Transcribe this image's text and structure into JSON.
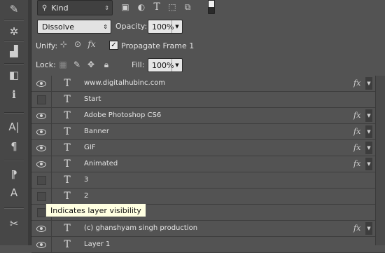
{
  "toolbar": {
    "tools": [
      {
        "icon": "brush-settings-icon",
        "glyph": "✎"
      },
      {
        "icon": "asterisk-icon",
        "glyph": "✲"
      },
      {
        "icon": "histogram-icon",
        "glyph": "▟"
      },
      {
        "icon": "adjustments-icon",
        "glyph": "◧"
      },
      {
        "icon": "info-icon",
        "glyph": "ℹ"
      },
      {
        "icon": "character-icon",
        "glyph": "A|"
      },
      {
        "icon": "paragraph-icon",
        "glyph": "¶"
      },
      {
        "icon": "paragraph-styles-icon",
        "glyph": "⁋"
      },
      {
        "icon": "character-styles-icon",
        "glyph": "A"
      },
      {
        "icon": "tools-icon",
        "glyph": "✂"
      }
    ]
  },
  "filter": {
    "kind_label": "Kind",
    "icons": [
      "image-filter-icon",
      "adjustment-filter-icon",
      "type-filter-icon",
      "shape-filter-icon",
      "smart-object-filter-icon"
    ]
  },
  "blend": {
    "mode": "Dissolve",
    "opacity_label": "Opacity:",
    "opacity_value": "100%"
  },
  "unify": {
    "label": "Unify:",
    "propagate_label": "Propagate Frame 1",
    "propagate_checked": true
  },
  "lock": {
    "label": "Lock:",
    "fill_label": "Fill:",
    "fill_value": "100%"
  },
  "layers": [
    {
      "name": "www.digitalhubinc.com",
      "visible": true,
      "fx": true
    },
    {
      "name": "Start",
      "visible": false,
      "fx": false
    },
    {
      "name": "Adobe Photoshop CS6",
      "visible": true,
      "fx": true
    },
    {
      "name": "Banner",
      "visible": true,
      "fx": true
    },
    {
      "name": "GIF",
      "visible": true,
      "fx": true
    },
    {
      "name": "Animated",
      "visible": true,
      "fx": true
    },
    {
      "name": "3",
      "visible": false,
      "fx": false
    },
    {
      "name": "2",
      "visible": false,
      "fx": false
    },
    {
      "name": "",
      "visible": false,
      "fx": false
    },
    {
      "name": "(c) ghanshyam singh production",
      "visible": true,
      "fx": true
    },
    {
      "name": "Layer 1",
      "visible": true,
      "fx": false
    }
  ],
  "tooltip": "Indicates layer visibility"
}
